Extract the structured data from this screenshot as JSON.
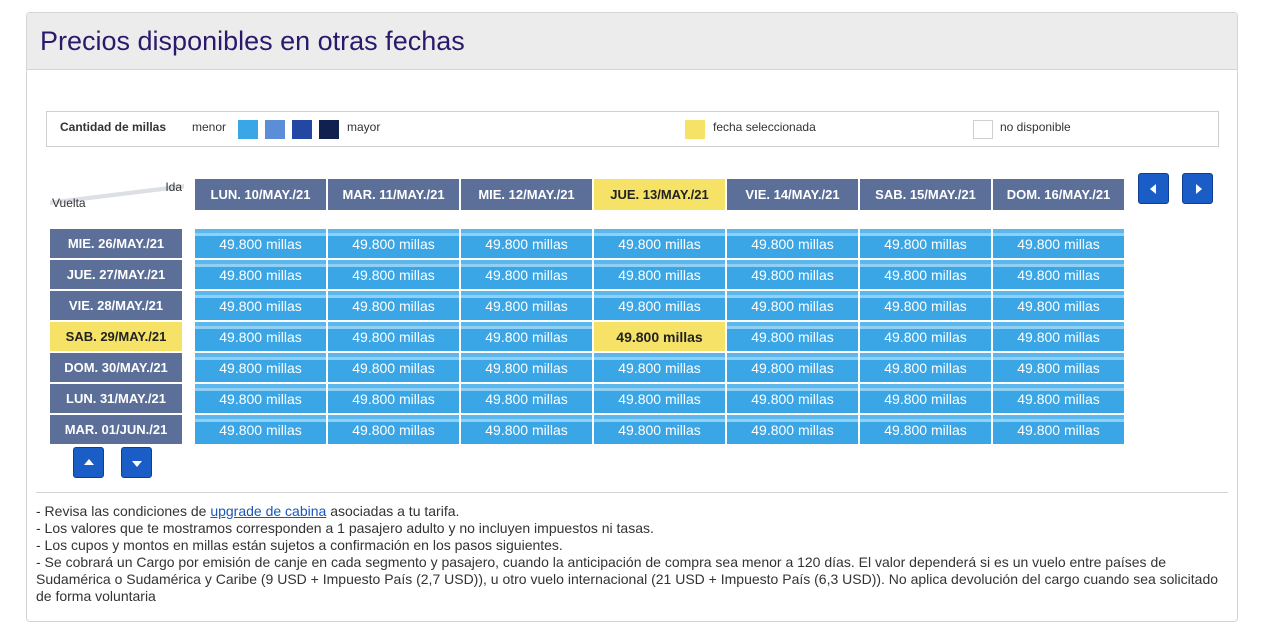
{
  "panel": {
    "title": "Precios disponibles en otras fechas"
  },
  "legend": {
    "title": "Cantidad de millas",
    "low_label": "menor",
    "high_label": "mayor",
    "swatch_colors": [
      "#3aa6e6",
      "#5b8ed6",
      "#2348a3",
      "#10214f"
    ],
    "selected_label": "fecha seleccionada",
    "selected_color": "#f5e266",
    "unavailable_label": "no disponible"
  },
  "grid": {
    "ida_label": "Ida",
    "vuelta_label": "Vuelta",
    "columns": [
      "LUN. 10/MAY./21",
      "MAR. 11/MAY./21",
      "MIE. 12/MAY./21",
      "JUE. 13/MAY./21",
      "VIE. 14/MAY./21",
      "SAB. 15/MAY./21",
      "DOM. 16/MAY./21"
    ],
    "rows": [
      "MIE. 26/MAY./21",
      "JUE. 27/MAY./21",
      "VIE. 28/MAY./21",
      "SAB. 29/MAY./21",
      "DOM. 30/MAY./21",
      "LUN. 31/MAY./21",
      "MAR. 01/JUN./21"
    ],
    "selected_column": 3,
    "selected_row": 3,
    "cells": [
      [
        "49.800 millas",
        "49.800 millas",
        "49.800 millas",
        "49.800 millas",
        "49.800 millas",
        "49.800 millas",
        "49.800 millas"
      ],
      [
        "49.800 millas",
        "49.800 millas",
        "49.800 millas",
        "49.800 millas",
        "49.800 millas",
        "49.800 millas",
        "49.800 millas"
      ],
      [
        "49.800 millas",
        "49.800 millas",
        "49.800 millas",
        "49.800 millas",
        "49.800 millas",
        "49.800 millas",
        "49.800 millas"
      ],
      [
        "49.800 millas",
        "49.800 millas",
        "49.800 millas",
        "49.800 millas",
        "49.800 millas",
        "49.800 millas",
        "49.800 millas"
      ],
      [
        "49.800 millas",
        "49.800 millas",
        "49.800 millas",
        "49.800 millas",
        "49.800 millas",
        "49.800 millas",
        "49.800 millas"
      ],
      [
        "49.800 millas",
        "49.800 millas",
        "49.800 millas",
        "49.800 millas",
        "49.800 millas",
        "49.800 millas",
        "49.800 millas"
      ],
      [
        "49.800 millas",
        "49.800 millas",
        "49.800 millas",
        "49.800 millas",
        "49.800 millas",
        "49.800 millas",
        "49.800 millas"
      ]
    ]
  },
  "nav": {
    "prev_icon": "arrow-left-icon",
    "next_icon": "arrow-right-icon",
    "up_icon": "arrow-up-icon",
    "down_icon": "arrow-down-icon"
  },
  "notes": {
    "line1_prefix": "- Revisa las condiciones de ",
    "line1_link": "upgrade de cabina",
    "line1_suffix": " asociadas a tu tarifa.",
    "line2": "- Los valores que te mostramos corresponden a 1 pasajero adulto y no incluyen impuestos ni tasas.",
    "line3": "- Los cupos y montos en millas están sujetos a confirmación en los pasos siguientes.",
    "line4": "- Se cobrará un Cargo por emisión de canje en cada segmento y pasajero, cuando la anticipación de compra sea menor a 120 días. El valor dependerá si es un vuelo entre países de Sudamérica o Sudamérica y Caribe (9 USD + Impuesto País (2,7 USD)), u otro vuelo internacional (21 USD + Impuesto País (6,3 USD)). No aplica devolución del cargo cuando sea solicitado de forma voluntaria"
  }
}
